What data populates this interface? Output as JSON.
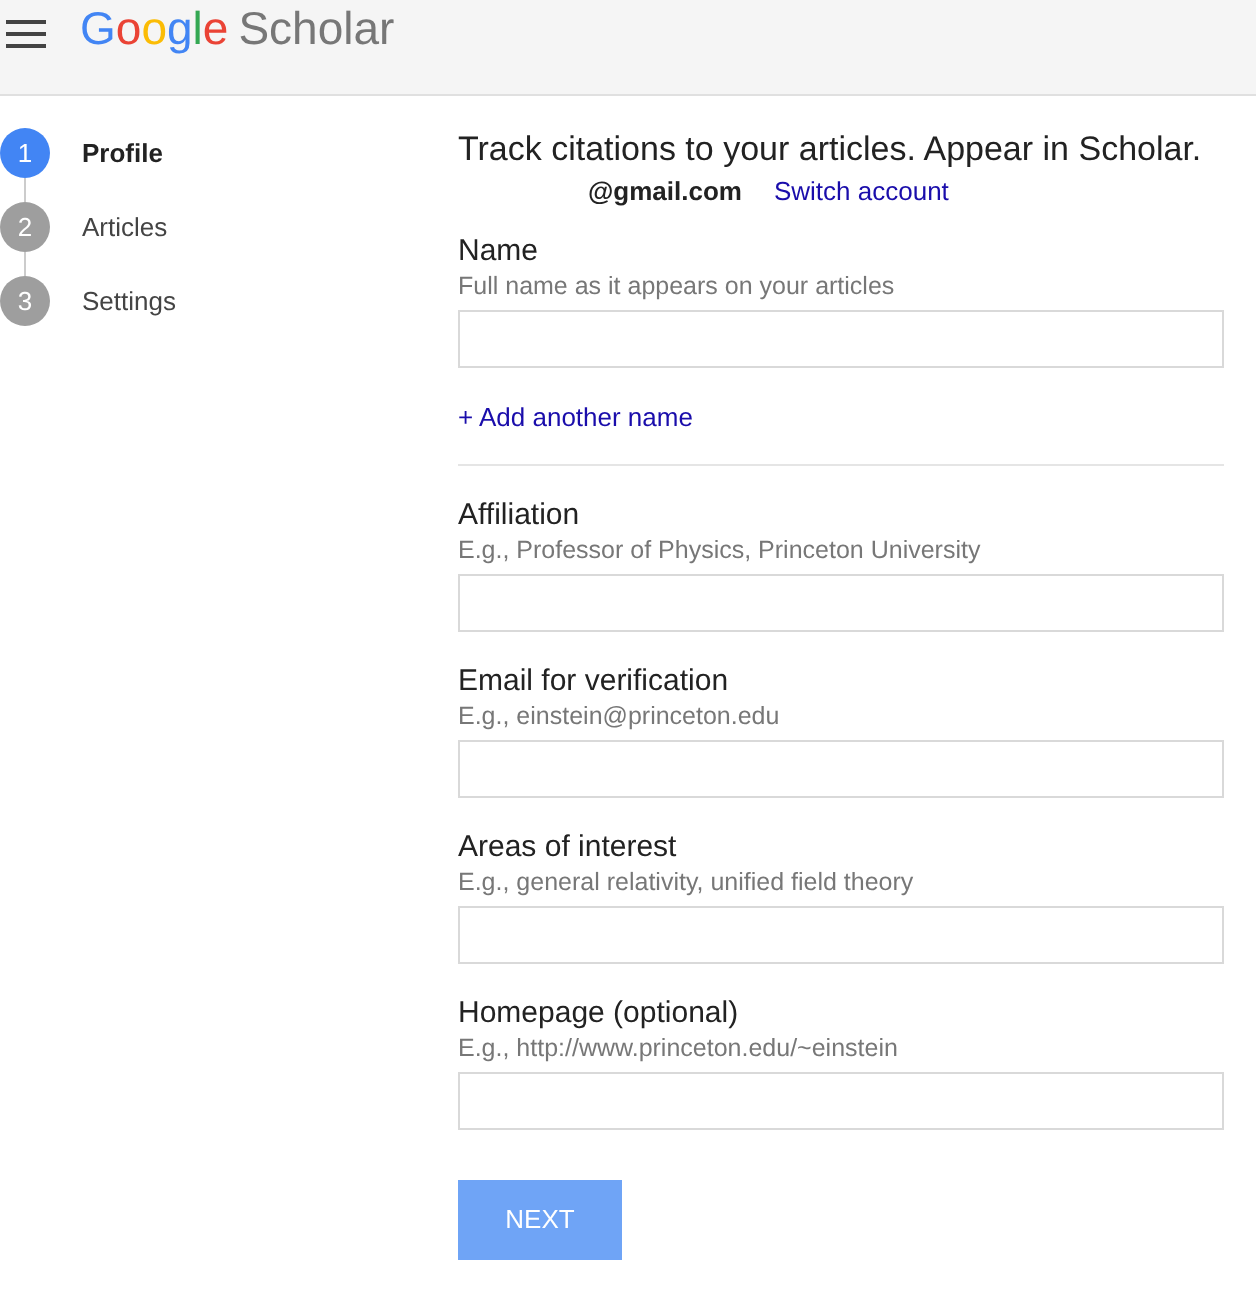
{
  "header": {
    "logo": "Google",
    "product": "Scholar"
  },
  "steps": [
    {
      "number": "1",
      "label": "Profile",
      "selected": true
    },
    {
      "number": "2",
      "label": "Articles",
      "selected": false
    },
    {
      "number": "3",
      "label": "Settings",
      "selected": false
    }
  ],
  "title": "Track citations to your articles. Appear in Scholar.",
  "account": {
    "email": "@gmail.com",
    "switch_link": "Switch account"
  },
  "fields": [
    {
      "label": "Name",
      "hint": "Full name as it appears on your articles",
      "link": "+ Add another name"
    },
    {
      "label": "Affiliation",
      "hint": "E.g., Professor of Physics, Princeton University"
    },
    {
      "label": "Email for verification",
      "hint": "E.g., einstein@princeton.edu"
    },
    {
      "label": "Areas of interest",
      "hint": "E.g., general relativity, unified field theory"
    },
    {
      "label": "Homepage (optional)",
      "hint": "E.g., http://www.princeton.edu/~einstein"
    }
  ],
  "next_button": "NEXT"
}
